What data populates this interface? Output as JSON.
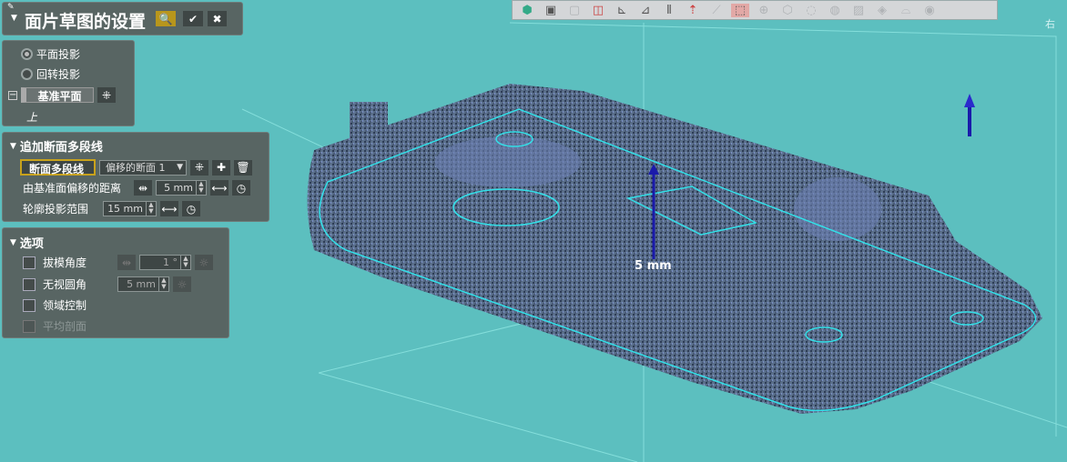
{
  "title_panel": {
    "title": "面片草图的设置"
  },
  "projection": {
    "options": [
      "平面投影",
      "回转投影"
    ],
    "selected": 0,
    "plane_label": "基准平面",
    "direction": "上"
  },
  "polyline": {
    "header": "追加断面多段线",
    "section_button": "断面多段线",
    "section_select": "偏移的断面 1",
    "offset_label": "由基准面偏移的距离",
    "offset_value": "5 mm",
    "range_label": "轮廓投影范围",
    "range_value": "15 mm"
  },
  "options": {
    "header": "选项",
    "items": [
      {
        "label": "拔模角度",
        "value": "1 °"
      },
      {
        "label": "无视圆角",
        "value": "5 mm"
      },
      {
        "label": "领域控制"
      },
      {
        "label": "平均剖面"
      }
    ]
  },
  "viewport": {
    "dimension_label": "5 mm",
    "view_label": "右"
  },
  "colors": {
    "background": "#5cbfbf",
    "panel": "#586563",
    "accent": "#c8a21c",
    "outline": "#33e0e8"
  }
}
